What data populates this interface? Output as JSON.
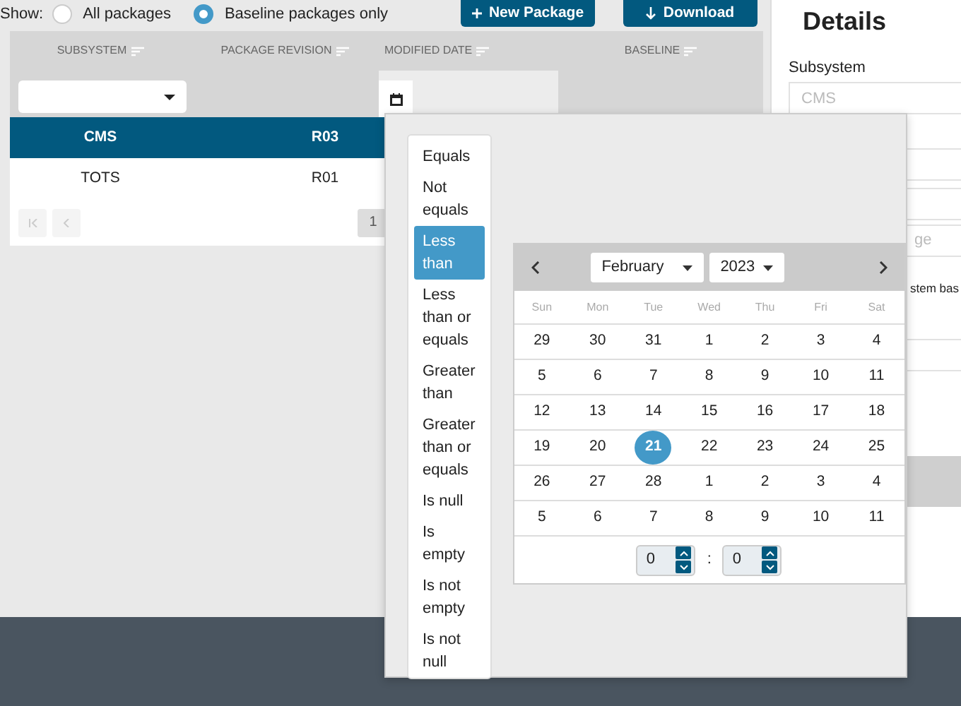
{
  "filter_bar": {
    "label": "Show:",
    "options": [
      {
        "label": "All packages",
        "selected": false
      },
      {
        "label": "Baseline packages only",
        "selected": true
      }
    ]
  },
  "toolbar": {
    "buttons": [
      {
        "label": "New Package"
      },
      {
        "label": "Download"
      }
    ]
  },
  "table": {
    "columns": [
      "SUBSYSTEM",
      "PACKAGE REVISION",
      "MODIFIED DATE",
      "BASELINE"
    ],
    "rows": [
      {
        "cells": [
          "CMS",
          "R03"
        ],
        "selected": true
      },
      {
        "cells": [
          "TOTS",
          "R01"
        ],
        "selected": false
      }
    ],
    "pager": {
      "page": "1"
    }
  },
  "details": {
    "title": "Details",
    "fields": [
      {
        "label": "Subsystem",
        "placeholder": "CMS"
      },
      {
        "placeholder": "ge"
      },
      {
        "label": "stem bas"
      }
    ]
  },
  "filter_popup": {
    "operators": [
      {
        "label": "Equals",
        "selected": false
      },
      {
        "label": "Not equals",
        "selected": false
      },
      {
        "label": "Less than",
        "selected": true
      },
      {
        "label": "Less than or equals",
        "selected": false
      },
      {
        "label": "Greater than",
        "selected": false
      },
      {
        "label": "Greater than or equals",
        "selected": false
      },
      {
        "label": "Is null",
        "selected": false
      },
      {
        "label": "Is empty",
        "selected": false
      },
      {
        "label": "Is not empty",
        "selected": false
      },
      {
        "label": "Is not null",
        "selected": false
      }
    ],
    "calendar": {
      "month": "February",
      "year": "2023",
      "weekdays": [
        "Sun",
        "Mon",
        "Tue",
        "Wed",
        "Thu",
        "Fri",
        "Sat"
      ],
      "weeks": [
        [
          {
            "day": "29",
            "selected": false
          },
          {
            "day": "30",
            "selected": false
          },
          {
            "day": "31",
            "selected": false
          },
          {
            "day": "1",
            "selected": false
          },
          {
            "day": "2",
            "selected": false
          },
          {
            "day": "3",
            "selected": false
          },
          {
            "day": "4",
            "selected": false
          }
        ],
        [
          {
            "day": "5",
            "selected": false
          },
          {
            "day": "6",
            "selected": false
          },
          {
            "day": "7",
            "selected": false
          },
          {
            "day": "8",
            "selected": false
          },
          {
            "day": "9",
            "selected": false
          },
          {
            "day": "10",
            "selected": false
          },
          {
            "day": "11",
            "selected": false
          }
        ],
        [
          {
            "day": "12",
            "selected": false
          },
          {
            "day": "13",
            "selected": false
          },
          {
            "day": "14",
            "selected": false
          },
          {
            "day": "15",
            "selected": false
          },
          {
            "day": "16",
            "selected": false
          },
          {
            "day": "17",
            "selected": false
          },
          {
            "day": "18",
            "selected": false
          }
        ],
        [
          {
            "day": "19",
            "selected": false
          },
          {
            "day": "20",
            "selected": false
          },
          {
            "day": "21",
            "selected": true
          },
          {
            "day": "22",
            "selected": false
          },
          {
            "day": "23",
            "selected": false
          },
          {
            "day": "24",
            "selected": false
          },
          {
            "day": "25",
            "selected": false
          }
        ],
        [
          {
            "day": "26",
            "selected": false
          },
          {
            "day": "27",
            "selected": false
          },
          {
            "day": "28",
            "selected": false
          },
          {
            "day": "1",
            "selected": false
          },
          {
            "day": "2",
            "selected": false
          },
          {
            "day": "3",
            "selected": false
          },
          {
            "day": "4",
            "selected": false
          }
        ],
        [
          {
            "day": "5",
            "selected": false
          },
          {
            "day": "6",
            "selected": false
          },
          {
            "day": "7",
            "selected": false
          },
          {
            "day": "8",
            "selected": false
          },
          {
            "day": "9",
            "selected": false
          },
          {
            "day": "10",
            "selected": false
          },
          {
            "day": "11",
            "selected": false
          }
        ]
      ],
      "hour": "0",
      "separator": ":",
      "minute": "0"
    }
  }
}
